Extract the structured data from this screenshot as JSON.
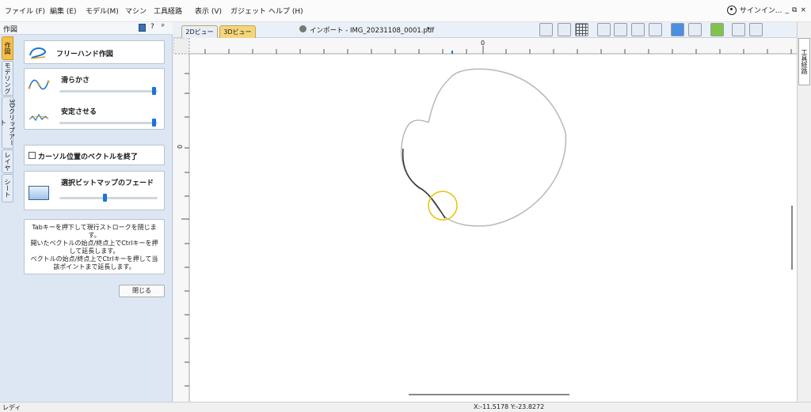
{
  "menu": [
    "ファイル (F)",
    "編集 (E)",
    "モデル(M)",
    "マシン",
    "工具経路",
    "表示 (V)",
    "ガジェット",
    "ヘルプ (H)"
  ],
  "user": {
    "label": "サインイン..."
  },
  "window_controls": [
    "_",
    "⧉",
    "×"
  ],
  "panel": {
    "title": "作図",
    "pin_icons": [
      "?",
      "ᵖ"
    ],
    "tabs": [
      "作図",
      "モデリング",
      "3Dクリップアート",
      "レイヤ",
      "シート"
    ],
    "freehand": {
      "label": "フリーハンド作図"
    },
    "smoothness": {
      "label": "滑らかさ",
      "value": 1.0
    },
    "stabilize": {
      "label": "安定させる",
      "value": 1.0
    },
    "end_vector": {
      "label": "カーソル位置のベクトルを終了",
      "checked": false
    },
    "fade": {
      "label": "選択ビットマップのフェード",
      "value": 0.5
    },
    "help_lines": [
      "Tabキーを押下して現行ストロークを閉じます。",
      "開いたベクトルの始点/終点上でCtrlキーを押",
      "して延長します。",
      "ベクトルの始点/終点上でCtrlキーを押して当",
      "該ポイントまで延長します。"
    ],
    "close_label": "閉じる"
  },
  "viewtabs": {
    "tab2d": "2Dビュー",
    "tab3d": "3Dビュー",
    "doc_title": "インポート - IMG_20231108_0001.pdf"
  },
  "ruler": {
    "h_zero": "0",
    "v_zero": "0"
  },
  "right_tab": {
    "label": "工具経路"
  },
  "status": {
    "left": "レディ",
    "coords": "X:-11.5178 Y:-23.8272"
  },
  "colors": {
    "accent": "#1a73d8",
    "tab_active": "#f6c04a",
    "panel_bg": "#dde7f4"
  }
}
